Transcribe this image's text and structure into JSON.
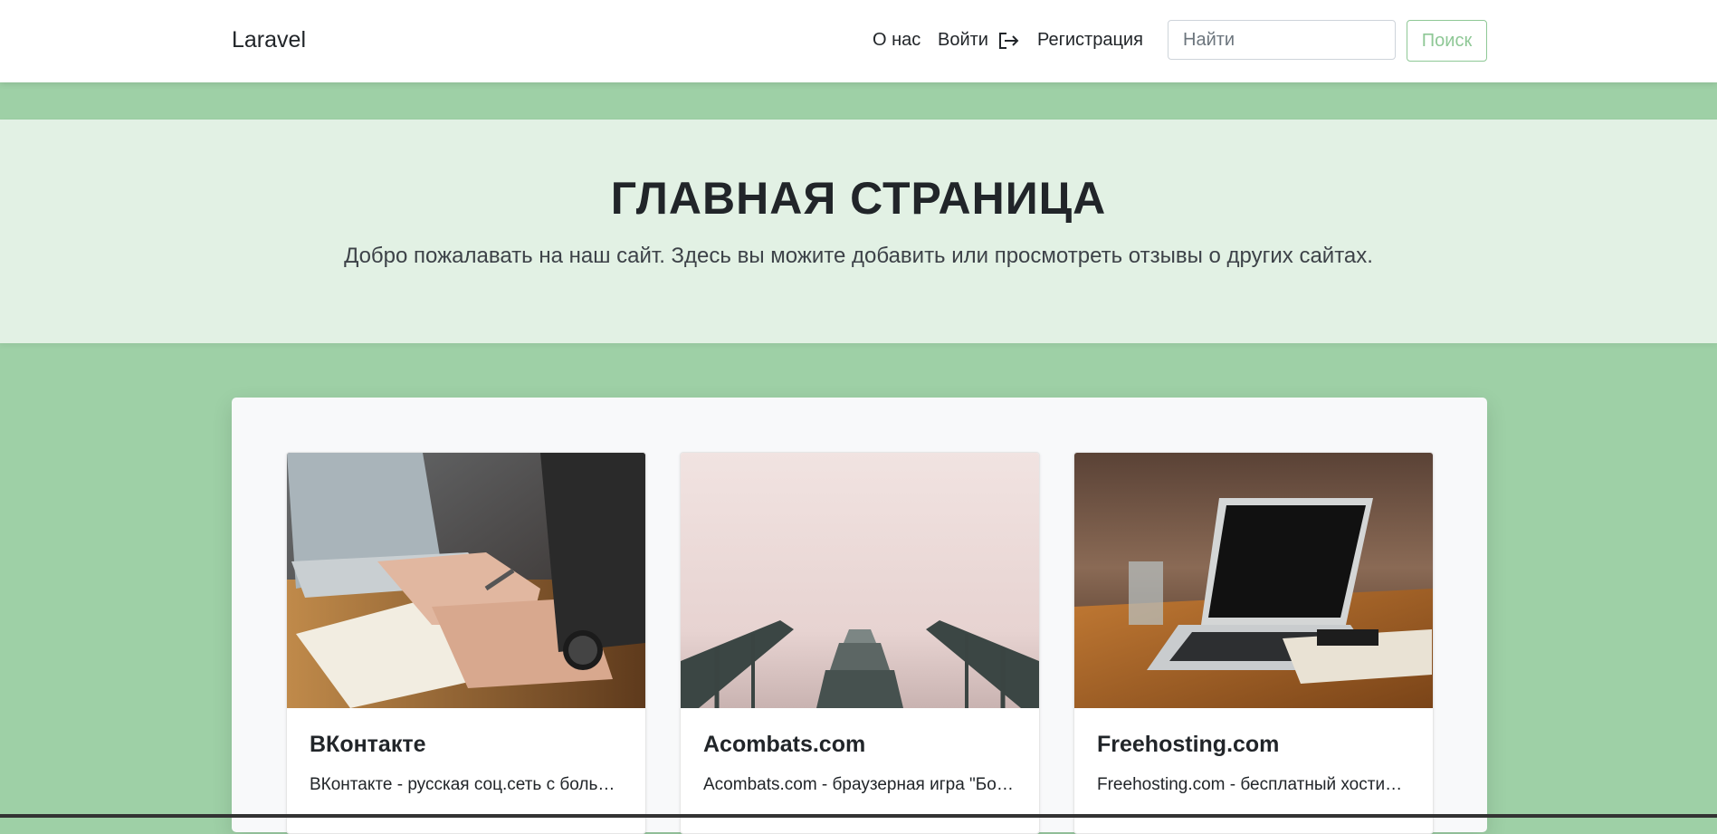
{
  "navbar": {
    "brand": "Laravel",
    "links": {
      "about": "О нас",
      "login": "Войти",
      "register": "Регистрация"
    },
    "search": {
      "placeholder": "Найти",
      "button_label": "Поиск"
    }
  },
  "hero": {
    "title": "ГЛАВНАЯ СТРАНИЦА",
    "subtitle": "Добро пожалавать на наш сайт. Здесь вы можите добавить или просмотреть отзывы о других сайтах."
  },
  "cards": [
    {
      "image": "hands-writing-notebook-laptop-photo",
      "title": "ВКонтакте",
      "text": "ВКонтакте - русская соц.сеть с большим количеством пользователей"
    },
    {
      "image": "foggy-stairs-photo",
      "title": "Acombats.com",
      "text": "Acombats.com - браузерная игра \"Бойцовский клуб\""
    },
    {
      "image": "laptop-on-wooden-table-photo",
      "title": "Freehosting.com",
      "text": "Freehosting.com - бесплатный хостинг для сайтов"
    }
  ],
  "colors": {
    "page_background": "#9ed0a6",
    "hero_background": "#e2f1e4",
    "accent": "#8fc896"
  },
  "icons": {
    "login": "login-arrow-icon"
  }
}
